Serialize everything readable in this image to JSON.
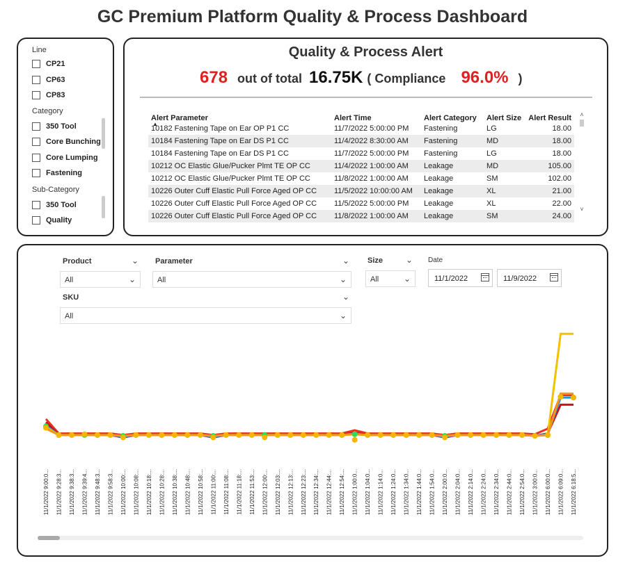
{
  "page": {
    "title": "GC Premium Platform Quality & Process Dashboard"
  },
  "filters": {
    "line": {
      "label": "Line",
      "options": [
        "CP21",
        "CP63",
        "CP83"
      ]
    },
    "category": {
      "label": "Category",
      "options": [
        "350 Tool",
        "Core Bunching",
        "Core Lumping",
        "Fastening"
      ]
    },
    "subcategory": {
      "label": "Sub-Category",
      "options": [
        "350 Tool",
        "Quality"
      ]
    }
  },
  "alert": {
    "title": "Quality & Process Alert",
    "count": "678",
    "out_of_text": "out of total",
    "total": "16.75K",
    "compliance_label": "( Compliance",
    "compliance_value": "96.0%",
    "close_paren": ")",
    "columns": [
      "Alert Parameter",
      "Alert Time",
      "Alert Category",
      "Alert Size",
      "Alert Result"
    ],
    "rows": [
      [
        "10182 Fastening Tape on Ear OP P1 CC",
        "11/7/2022 5:00:00 PM",
        "Fastening",
        "LG",
        "18.00"
      ],
      [
        "10184 Fastening Tape on Ear DS P1 CC",
        "11/4/2022 8:30:00 AM",
        "Fastening",
        "MD",
        "18.00"
      ],
      [
        "10184 Fastening Tape on Ear DS P1 CC",
        "11/7/2022 5:00:00 PM",
        "Fastening",
        "LG",
        "18.00"
      ],
      [
        "10212 OC Elastic Glue/Pucker Plmt TE OP CC",
        "11/4/2022 1:00:00 AM",
        "Leakage",
        "MD",
        "105.00"
      ],
      [
        "10212 OC Elastic Glue/Pucker Plmt TE OP CC",
        "11/8/2022 1:00:00 AM",
        "Leakage",
        "SM",
        "102.00"
      ],
      [
        "10226 Outer Cuff Elastic Pull Force Aged OP CC",
        "11/5/2022 10:00:00 AM",
        "Leakage",
        "XL",
        "21.00"
      ],
      [
        "10226 Outer Cuff Elastic Pull Force Aged OP CC",
        "11/5/2022 5:00:00 PM",
        "Leakage",
        "XL",
        "22.00"
      ],
      [
        "10226 Outer Cuff Elastic Pull Force Aged OP CC",
        "11/8/2022 1:00:00 AM",
        "Leakage",
        "SM",
        "24.00"
      ]
    ]
  },
  "chart_filters": {
    "product": {
      "label": "Product",
      "value": "All"
    },
    "parameter": {
      "label": "Parameter",
      "value": "All"
    },
    "size": {
      "label": "Size",
      "value": "All"
    },
    "date": {
      "label": "Date",
      "start": "11/1/2022",
      "end": "11/9/2022"
    },
    "sku": {
      "label": "SKU",
      "value": "All"
    }
  },
  "colors": {
    "red_kpi": "#e02020",
    "line_red": "#e8321e",
    "line_darkred": "#c0141a",
    "line_blue": "#2b8fe0",
    "line_yellow": "#f2c200",
    "line_orange": "#f7941d",
    "marker_green": "#2ee04a",
    "marker_yellow": "#f7b500"
  },
  "chart_data": {
    "type": "line",
    "x": [
      "11/1/2022 9:00:0...",
      "11/1/2022 9:28:3...",
      "11/1/2022 9:38:3...",
      "11/1/2022 9:39:4...",
      "11/1/2022 9:48:3...",
      "11/1/2022 9:58:3...",
      "11/1/2022 10:00:...",
      "11/1/2022 10:08:...",
      "11/1/2022 10:18:...",
      "11/1/2022 10:28:...",
      "11/1/2022 10:38:...",
      "11/1/2022 10:48:...",
      "11/1/2022 10:58:...",
      "11/1/2022 11:00:...",
      "11/1/2022 11:08:...",
      "11/1/2022 11:18:...",
      "11/1/2022 11:53:...",
      "11/1/2022 12:00:...",
      "11/1/2022 12:03:...",
      "11/1/2022 12:13:...",
      "11/1/2022 12:23:...",
      "11/1/2022 12:34:...",
      "11/1/2022 12:44:...",
      "11/1/2022 12:54:...",
      "11/1/2022 1:00:0...",
      "11/1/2022 1:04:0...",
      "11/1/2022 1:14:0...",
      "11/1/2022 1:24:0...",
      "11/1/2022 1:34:0...",
      "11/1/2022 1:44:0...",
      "11/1/2022 1:54:0...",
      "11/1/2022 2:00:0...",
      "11/1/2022 2:04:0...",
      "11/1/2022 2:14:0...",
      "11/1/2022 2:24:0...",
      "11/1/2022 2:34:0...",
      "11/1/2022 2:44:0...",
      "11/1/2022 2:54:0...",
      "11/1/2022 3:00:0...",
      "11/1/2022 6:00:0...",
      "11/1/2022 6:09:0...",
      "11/1/2022 6:18:5..."
    ],
    "series": [
      {
        "color": "#e8321e",
        "marker": "none",
        "values": [
          48,
          30,
          30,
          30,
          30,
          30,
          28,
          30,
          30,
          30,
          30,
          30,
          30,
          28,
          30,
          30,
          30,
          30,
          30,
          30,
          30,
          30,
          30,
          30,
          34,
          30,
          30,
          30,
          30,
          30,
          30,
          28,
          30,
          30,
          30,
          30,
          30,
          30,
          29,
          36,
          78,
          78
        ]
      },
      {
        "color": "#c0141a",
        "marker": "none",
        "values": [
          44,
          28,
          28,
          28,
          28,
          28,
          25,
          28,
          28,
          28,
          28,
          28,
          28,
          25,
          28,
          28,
          28,
          28,
          28,
          28,
          28,
          28,
          28,
          28,
          31,
          28,
          28,
          28,
          28,
          28,
          28,
          25,
          28,
          28,
          28,
          28,
          28,
          28,
          27,
          30,
          66,
          66
        ]
      },
      {
        "color": "#2b8fe0",
        "marker": "none",
        "values": [
          40,
          28,
          28,
          28,
          28,
          28,
          26,
          28,
          28,
          28,
          28,
          28,
          28,
          26,
          28,
          28,
          28,
          28,
          28,
          28,
          28,
          28,
          28,
          28,
          30,
          28,
          28,
          28,
          28,
          28,
          28,
          26,
          28,
          28,
          28,
          28,
          28,
          28,
          27,
          29,
          75,
          75
        ]
      },
      {
        "color": "#f2c200",
        "marker": "none",
        "values": [
          38,
          28,
          28,
          28,
          28,
          28,
          27,
          28,
          28,
          28,
          28,
          28,
          28,
          27,
          28,
          28,
          28,
          28,
          28,
          28,
          28,
          28,
          28,
          28,
          29,
          28,
          28,
          28,
          28,
          28,
          28,
          27,
          28,
          28,
          28,
          28,
          28,
          28,
          27,
          28,
          155,
          155
        ]
      },
      {
        "color": "#f7941d",
        "marker": "none",
        "values": [
          36,
          28,
          28,
          28,
          28,
          28,
          27,
          28,
          28,
          28,
          28,
          28,
          28,
          27,
          28,
          28,
          28,
          28,
          28,
          28,
          28,
          28,
          28,
          28,
          29,
          28,
          28,
          28,
          28,
          28,
          28,
          27,
          28,
          28,
          28,
          28,
          28,
          28,
          27,
          28,
          80,
          80
        ]
      },
      {
        "color": "#2ee04a",
        "marker": "dot",
        "values": [
          39,
          28,
          28,
          28,
          28,
          28,
          27,
          28,
          28,
          28,
          28,
          28,
          28,
          27,
          28,
          28,
          28,
          28,
          28,
          28,
          28,
          28,
          28,
          28,
          29,
          28,
          28,
          28,
          28,
          28,
          28,
          27,
          28,
          28,
          28,
          28,
          28,
          28,
          27,
          28,
          76,
          75
        ]
      },
      {
        "color": "#f7b500",
        "marker": "dot",
        "values": [
          37,
          28,
          28,
          29,
          28,
          28,
          25,
          28,
          28,
          28,
          28,
          28,
          28,
          25,
          28,
          28,
          28,
          25,
          28,
          28,
          28,
          28,
          28,
          28,
          22,
          28,
          28,
          28,
          28,
          28,
          28,
          25,
          28,
          28,
          28,
          28,
          28,
          28,
          27,
          28,
          76,
          75
        ]
      }
    ],
    "ylim": [
      0,
      170
    ],
    "grid": false,
    "legend": "none"
  }
}
